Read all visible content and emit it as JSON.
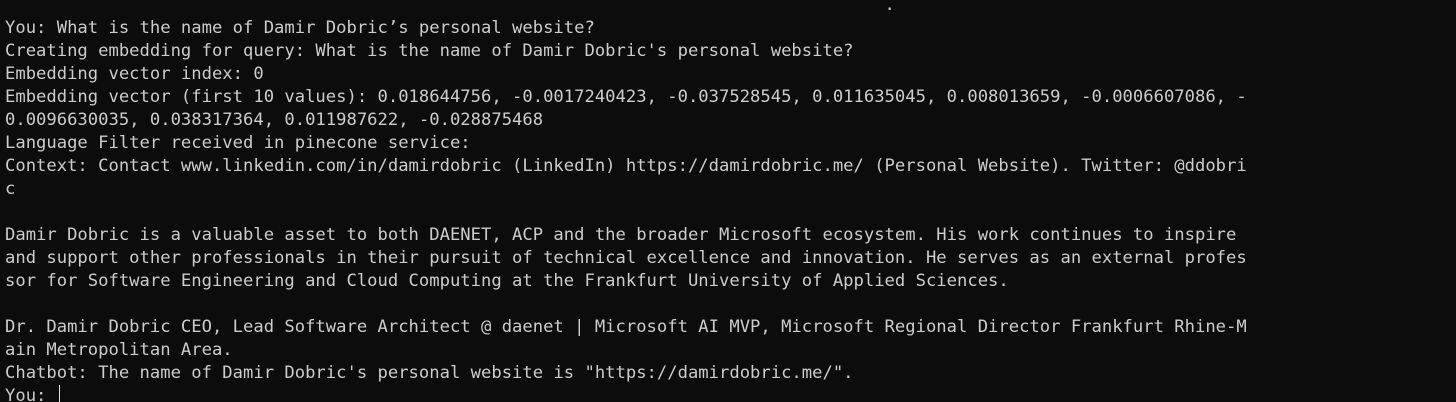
{
  "terminal": {
    "lines": [
      "                                                                                     .",
      "You: What is the name of Damir Dobric’s personal website?",
      "Creating embedding for query: What is the name of Damir Dobric's personal website?",
      "Embedding vector index: 0",
      "Embedding vector (first 10 values): 0.018644756, -0.0017240423, -0.037528545, 0.011635045, 0.008013659, -0.0006607086, -",
      "0.0096630035, 0.038317364, 0.011987622, -0.028875468",
      "Language Filter received in pinecone service:",
      "Context: Contact www.linkedin.com/in/damirdobric (LinkedIn) https://damirdobric.me/ (Personal Website). Twitter: @ddobri",
      "c",
      "",
      "Damir Dobric is a valuable asset to both DAENET, ACP and the broader Microsoft ecosystem. His work continues to inspire",
      "and support other professionals in their pursuit of technical excellence and innovation. He serves as an external profes",
      "sor for Software Engineering and Cloud Computing at the Frankfurt University of Applied Sciences.",
      "",
      "Dr. Damir Dobric CEO, Lead Software Architect @ daenet | Microsoft AI MVP, Microsoft Regional Director Frankfurt Rhine-M",
      "ain Metropolitan Area.",
      "Chatbot: The name of Damir Dobric's personal website is \"https://damirdobric.me/\"."
    ],
    "input_prompt": "You: ",
    "input_value": ""
  }
}
